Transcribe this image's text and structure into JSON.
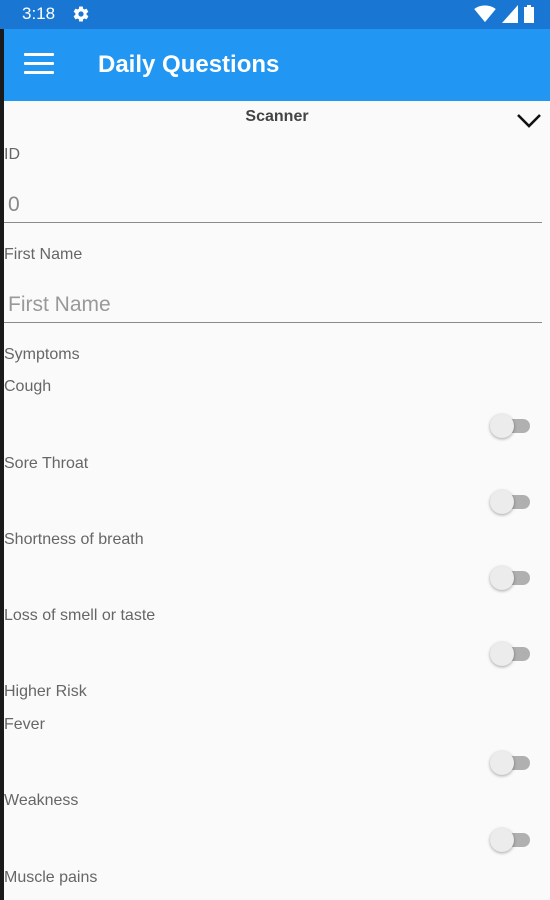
{
  "status_bar": {
    "time": "3:18"
  },
  "app_bar": {
    "title": "Daily Questions"
  },
  "picker": {
    "selected": "Scanner"
  },
  "form": {
    "id_label": "ID",
    "id_value": "0",
    "first_name_label": "First Name",
    "first_name_placeholder": "First Name",
    "symptoms_header": "Symptoms",
    "higher_risk_header": "Higher Risk"
  },
  "symptoms": [
    {
      "label": "Cough",
      "on": false
    },
    {
      "label": "Sore Throat",
      "on": false
    },
    {
      "label": "Shortness of breath",
      "on": false
    },
    {
      "label": "Loss of smell or taste",
      "on": false
    }
  ],
  "higher_risk": [
    {
      "label": "Fever",
      "on": false
    },
    {
      "label": "Weakness",
      "on": false
    },
    {
      "label": "Muscle pains",
      "on": false
    }
  ]
}
